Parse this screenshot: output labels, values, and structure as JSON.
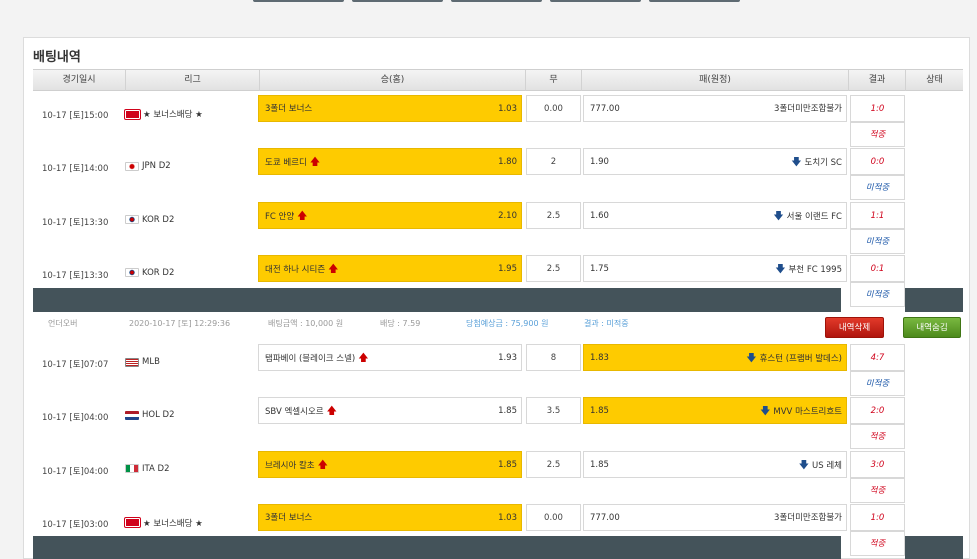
{
  "panel": {
    "title": "배팅내역"
  },
  "headers": [
    "경기일시",
    "리그",
    "승(홈)",
    "무",
    "패(원정)",
    "결과",
    "상태"
  ],
  "group1": [
    {
      "date": "10-17 [토]15:00",
      "league": "★ 보너스배당 ★",
      "flag": "bonus-flag",
      "home": "3폴더 보너스",
      "home_odds": "1.03",
      "home_arrow": "",
      "home_sel": true,
      "draw": "0.00",
      "away": "3폴더미만조합불가",
      "away_odds": "777.00",
      "away_arrow": "",
      "away_sel": false,
      "result": "1:0",
      "status": "적중",
      "status_color": "red"
    },
    {
      "date": "10-17 [토]14:00",
      "league": "JPN D2",
      "flag": "japan-flag",
      "home": "도쿄 베르디",
      "home_odds": "1.80",
      "home_arrow": "up",
      "home_sel": true,
      "draw": "2",
      "away": "도치기 SC",
      "away_odds": "1.90",
      "away_arrow": "down",
      "away_sel": false,
      "result": "0:0",
      "status": "미적중",
      "status_color": "blue"
    },
    {
      "date": "10-17 [토]13:30",
      "league": "KOR D2",
      "flag": "korea-flag",
      "home": "FC 안양",
      "home_odds": "2.10",
      "home_arrow": "up",
      "home_sel": true,
      "draw": "2.5",
      "away": "서울 이랜드 FC",
      "away_odds": "1.60",
      "away_arrow": "down",
      "away_sel": false,
      "result": "1:1",
      "status": "미적중",
      "status_color": "blue"
    },
    {
      "date": "10-17 [토]13:30",
      "league": "KOR D2",
      "flag": "korea-flag",
      "home": "대전 하나 시티즌",
      "home_odds": "1.95",
      "home_arrow": "up",
      "home_sel": true,
      "draw": "2.5",
      "away": "부천 FC 1995",
      "away_odds": "1.75",
      "away_arrow": "down",
      "away_sel": false,
      "result": "0:1",
      "status": "미적중",
      "status_color": "blue"
    }
  ],
  "summary": {
    "type": "언더오버",
    "datetime": "2020-10-17 [토] 12:29:36",
    "amount": "배팅금액 : 10,000 원",
    "odds": "배당 : 7.59",
    "expected": "당첨예상금 : 75,900 원",
    "result": "결과 : 미적중",
    "delete_label": "내역삭제",
    "hide_label": "내역숨김"
  },
  "group2": [
    {
      "date": "10-17 [토]07:07",
      "league": "MLB",
      "flag": "usa-flag",
      "home": "탬파베이 (블레이크 스넬)",
      "home_odds": "1.93",
      "home_arrow": "up",
      "home_sel": false,
      "draw": "8",
      "away": "휴스턴 (프램버 발데스)",
      "away_odds": "1.83",
      "away_arrow": "down",
      "away_sel": true,
      "result": "4:7",
      "status": "미적중",
      "status_color": "blue"
    },
    {
      "date": "10-17 [토]04:00",
      "league": "HOL D2",
      "flag": "netherlands-flag",
      "home": "SBV 엑셀시오르",
      "home_odds": "1.85",
      "home_arrow": "up",
      "home_sel": false,
      "draw": "3.5",
      "away": "MVV 마스트리흐트",
      "away_odds": "1.85",
      "away_arrow": "down",
      "away_sel": true,
      "result": "2:0",
      "status": "적중",
      "status_color": "red"
    },
    {
      "date": "10-17 [토]04:00",
      "league": "ITA D2",
      "flag": "italy-flag",
      "home": "브레시아 칼초",
      "home_odds": "1.85",
      "home_arrow": "up",
      "home_sel": true,
      "draw": "2.5",
      "away": "US 레체",
      "away_odds": "1.85",
      "away_arrow": "down",
      "away_sel": false,
      "result": "3:0",
      "status": "적중",
      "status_color": "red"
    },
    {
      "date": "10-17 [토]03:00",
      "league": "★ 보너스배당 ★",
      "flag": "bonus-flag",
      "home": "3폴더 보너스",
      "home_odds": "1.03",
      "home_arrow": "",
      "home_sel": true,
      "draw": "0.00",
      "away": "3폴더미만조합불가",
      "away_odds": "777.00",
      "away_arrow": "",
      "away_sel": false,
      "result": "1:0",
      "status": "적중",
      "status_color": "red"
    }
  ]
}
